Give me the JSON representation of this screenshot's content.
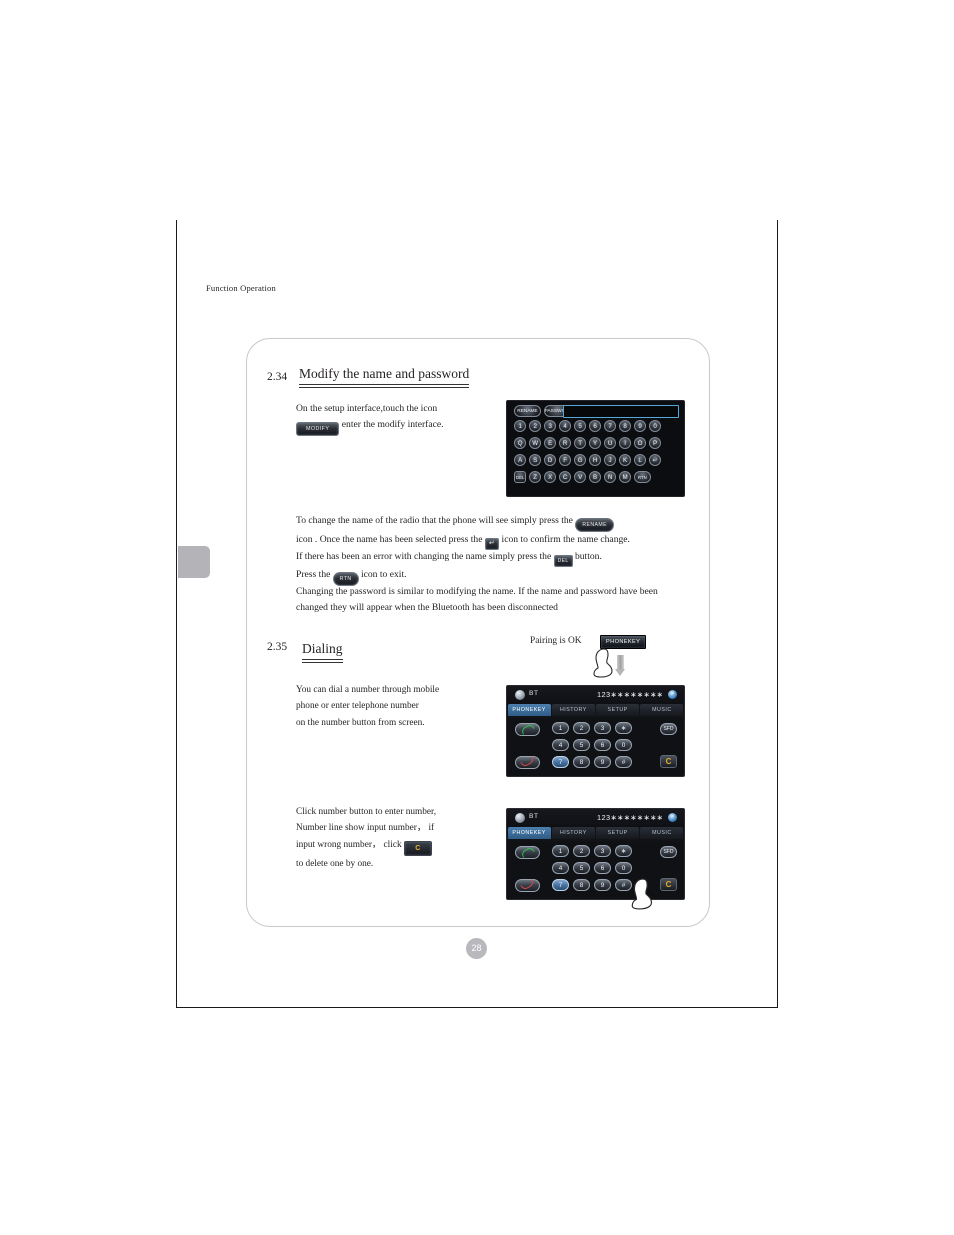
{
  "running_head": "Function Operation",
  "page_number": "28",
  "sections": [
    {
      "number": "2.34",
      "title": "Modify the name and password",
      "paragraphs": [
        {
          "id": "p1a",
          "text": "On the setup interface,touch the icon"
        },
        {
          "id": "p1b_pre",
          "text": "",
          "button": "MODIFY",
          "after": " enter the modify interface."
        },
        {
          "id": "p2",
          "text_1": "To change the name of the radio that the phone will see simply press the ",
          "btn_1": "RENAME",
          "text_2": "icon . Once the name has been selected press the ",
          "btn_2": "↵",
          "text_3": " icon to confirm the name change."
        },
        {
          "id": "p3",
          "text_1": "If there has been an error with changing the name simply press the ",
          "btn_1": "DEL",
          "text_2": " button.",
          "text_3": "Press the ",
          "btn_2": "RTN",
          "text_4": " icon to exit."
        },
        {
          "id": "p4",
          "text": "Changing the password is similar to modifying the name. If the name and password have been changed they will appear when the Bluetooth has been disconnected"
        }
      ]
    },
    {
      "number": "2.35",
      "title": "Dialing",
      "paragraphs": [
        {
          "id": "p5",
          "lines": [
            "You can dial a number through mobile",
            "phone or enter telephone number",
            "on the number button from screen."
          ]
        },
        {
          "id": "p6",
          "line_1": "Click number button to enter number,",
          "line_2": "Number line show input number， if",
          "line_3_pre": "input wrong number， click ",
          "line_3_btn": "C",
          "line_4": "to delete one by one."
        }
      ]
    }
  ],
  "pairing": {
    "label": "Pairing is OK",
    "button": "PHONEKEY"
  },
  "keyboard_screen": {
    "top_buttons": [
      "RENAME",
      "PASSWORD"
    ],
    "input_value": "",
    "rows": [
      [
        "1",
        "2",
        "3",
        "4",
        "5",
        "6",
        "7",
        "8",
        "9",
        "0"
      ],
      [
        "Q",
        "W",
        "E",
        "R",
        "T",
        "Y",
        "U",
        "I",
        "O",
        "P"
      ],
      [
        "A",
        "S",
        "D",
        "F",
        "G",
        "H",
        "J",
        "K",
        "L",
        "↵"
      ],
      [
        "DEL",
        "Z",
        "X",
        "C",
        "V",
        "B",
        "N",
        "M",
        "RTN"
      ]
    ]
  },
  "bt_screens": [
    {
      "id": "bt-screen-1",
      "device_label": "BT",
      "number_display": "123∗∗∗∗∗∗∗∗",
      "close_label": "×",
      "tabs": [
        "PHONEKEY",
        "HISTORY",
        "SETUP",
        "MUSIC"
      ],
      "active_tab": "PHONEKEY",
      "keys_row1": [
        "1",
        "2",
        "3",
        "∗"
      ],
      "keys_row2": [
        "4",
        "5",
        "6",
        "0"
      ],
      "keys_row3": [
        "7",
        "8",
        "9",
        "#"
      ],
      "highlighted_key": "7",
      "side_key": "SFD",
      "clear_key": "C",
      "has_hand": false
    },
    {
      "id": "bt-screen-2",
      "device_label": "BT",
      "number_display": "123∗∗∗∗∗∗∗∗",
      "close_label": "×",
      "tabs": [
        "PHONEKEY",
        "HISTORY",
        "SETUP",
        "MUSIC"
      ],
      "active_tab": "PHONEKEY",
      "keys_row1": [
        "1",
        "2",
        "3",
        "∗"
      ],
      "keys_row2": [
        "4",
        "5",
        "6",
        "0"
      ],
      "keys_row3": [
        "7",
        "8",
        "9",
        "#"
      ],
      "highlighted_key": "7",
      "side_key": "SFD",
      "clear_key": "C",
      "has_hand": true
    }
  ],
  "colors": {
    "accent_blue": "#56a8d8",
    "tab_active": "#4c7fae",
    "clear_amber": "#e0ad2b",
    "side_tab_gray": "#b3b3b8",
    "page_num_gray": "#b9b9bd"
  }
}
